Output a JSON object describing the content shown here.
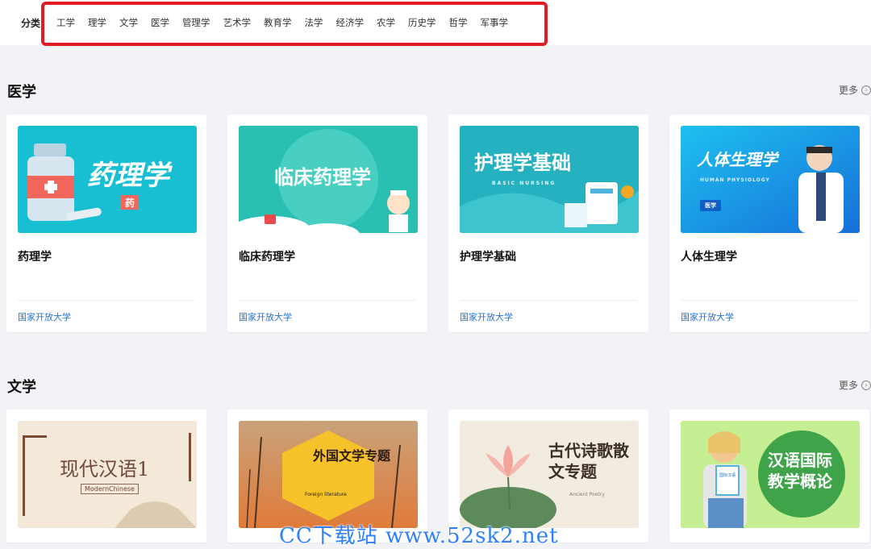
{
  "categories": {
    "label": "分类",
    "items": [
      "工学",
      "理学",
      "文学",
      "医学",
      "管理学",
      "艺术学",
      "教育学",
      "法学",
      "经济学",
      "农学",
      "历史学",
      "哲学",
      "军事学"
    ]
  },
  "sections": [
    {
      "title": "医学",
      "more": "更多",
      "courses": [
        {
          "name": "药理学",
          "school": "国家开放大学",
          "thumb_title": "药理学",
          "thumb_badge": "药"
        },
        {
          "name": "临床药理学",
          "school": "国家开放大学",
          "thumb_title": "临床药理学"
        },
        {
          "name": "护理学基础",
          "school": "国家开放大学",
          "thumb_title": "护理学基础",
          "thumb_sub": "BASIC NURSING"
        },
        {
          "name": "人体生理学",
          "school": "国家开放大学",
          "thumb_title": "人体生理学",
          "thumb_sub": "HUMAN PHYSIOLOGY",
          "thumb_badge": "医学"
        }
      ]
    },
    {
      "title": "文学",
      "more": "更多",
      "courses": [
        {
          "thumb_title": "现代汉语1",
          "thumb_sub": "ModernChinese"
        },
        {
          "thumb_title": "外国文学专题",
          "thumb_sub": "Foreign literature"
        },
        {
          "thumb_title": "古代诗歌散文专题",
          "thumb_sub": "Ancient Poetry"
        },
        {
          "thumb_title": "汉语国际教学概论",
          "thumb_badge": "国际汉语"
        }
      ]
    }
  ],
  "watermark": "CC下载站 www.52sk2.net",
  "colors": {
    "highlight_border": "#e31b23",
    "school_link": "#2a72c8",
    "page_bg": "#f2f3f6",
    "watermark": "#2f80ff"
  }
}
